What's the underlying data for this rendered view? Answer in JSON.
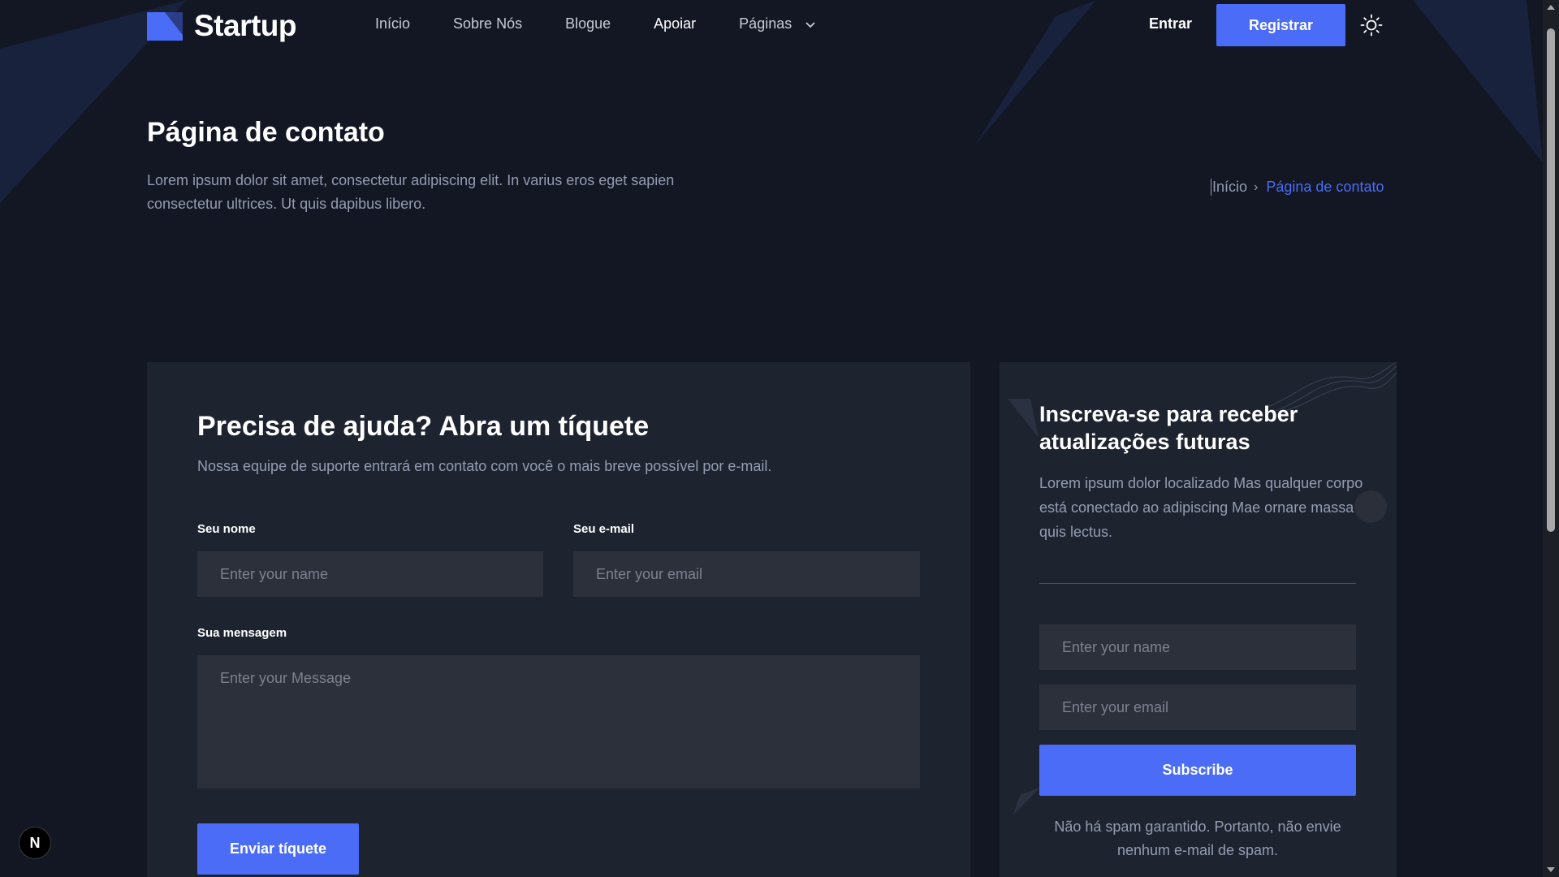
{
  "brand": {
    "name": "Startup",
    "accent": "#4a6cf7",
    "bg": "#121723",
    "card_bg": "#1d2430"
  },
  "nav": {
    "items": [
      {
        "label": "Início"
      },
      {
        "label": "Sobre Nós"
      },
      {
        "label": "Blogue"
      },
      {
        "label": "Apoiar"
      },
      {
        "label": "Páginas"
      }
    ],
    "signin_label": "Entrar",
    "register_label": "Registrar"
  },
  "hero": {
    "title": "Página de contato",
    "description": "Lorem ipsum dolor sit amet, consectetur adipiscing elit. In varius eros eget sapien consectetur ultrices. Ut quis dapibus libero.",
    "breadcrumb": {
      "home": "Início",
      "current": "Página de contato"
    }
  },
  "contact": {
    "title": "Precisa de ajuda? Abra um tíquete",
    "subtitle": "Nossa equipe de suporte entrará em contato com você o mais breve possível por e-mail.",
    "name_label": "Seu nome",
    "name_placeholder": "Enter your name",
    "email_label": "Seu e-mail",
    "email_placeholder": "Enter your email",
    "message_label": "Sua mensagem",
    "message_placeholder": "Enter your Message",
    "submit_label": "Enviar tíquete"
  },
  "newsletter": {
    "title": "Inscreva-se para receber atualizações futuras",
    "description": "Lorem ipsum dolor localizado Mas qualquer corpo está conectado ao adipiscing Mae ornare massa quis lectus.",
    "name_placeholder": "Enter your name",
    "email_placeholder": "Enter your email",
    "subscribe_label": "Subscribe",
    "note": "Não há spam garantido. Portanto, não envie nenhum e-mail de spam."
  },
  "badge": {
    "label": "N"
  }
}
